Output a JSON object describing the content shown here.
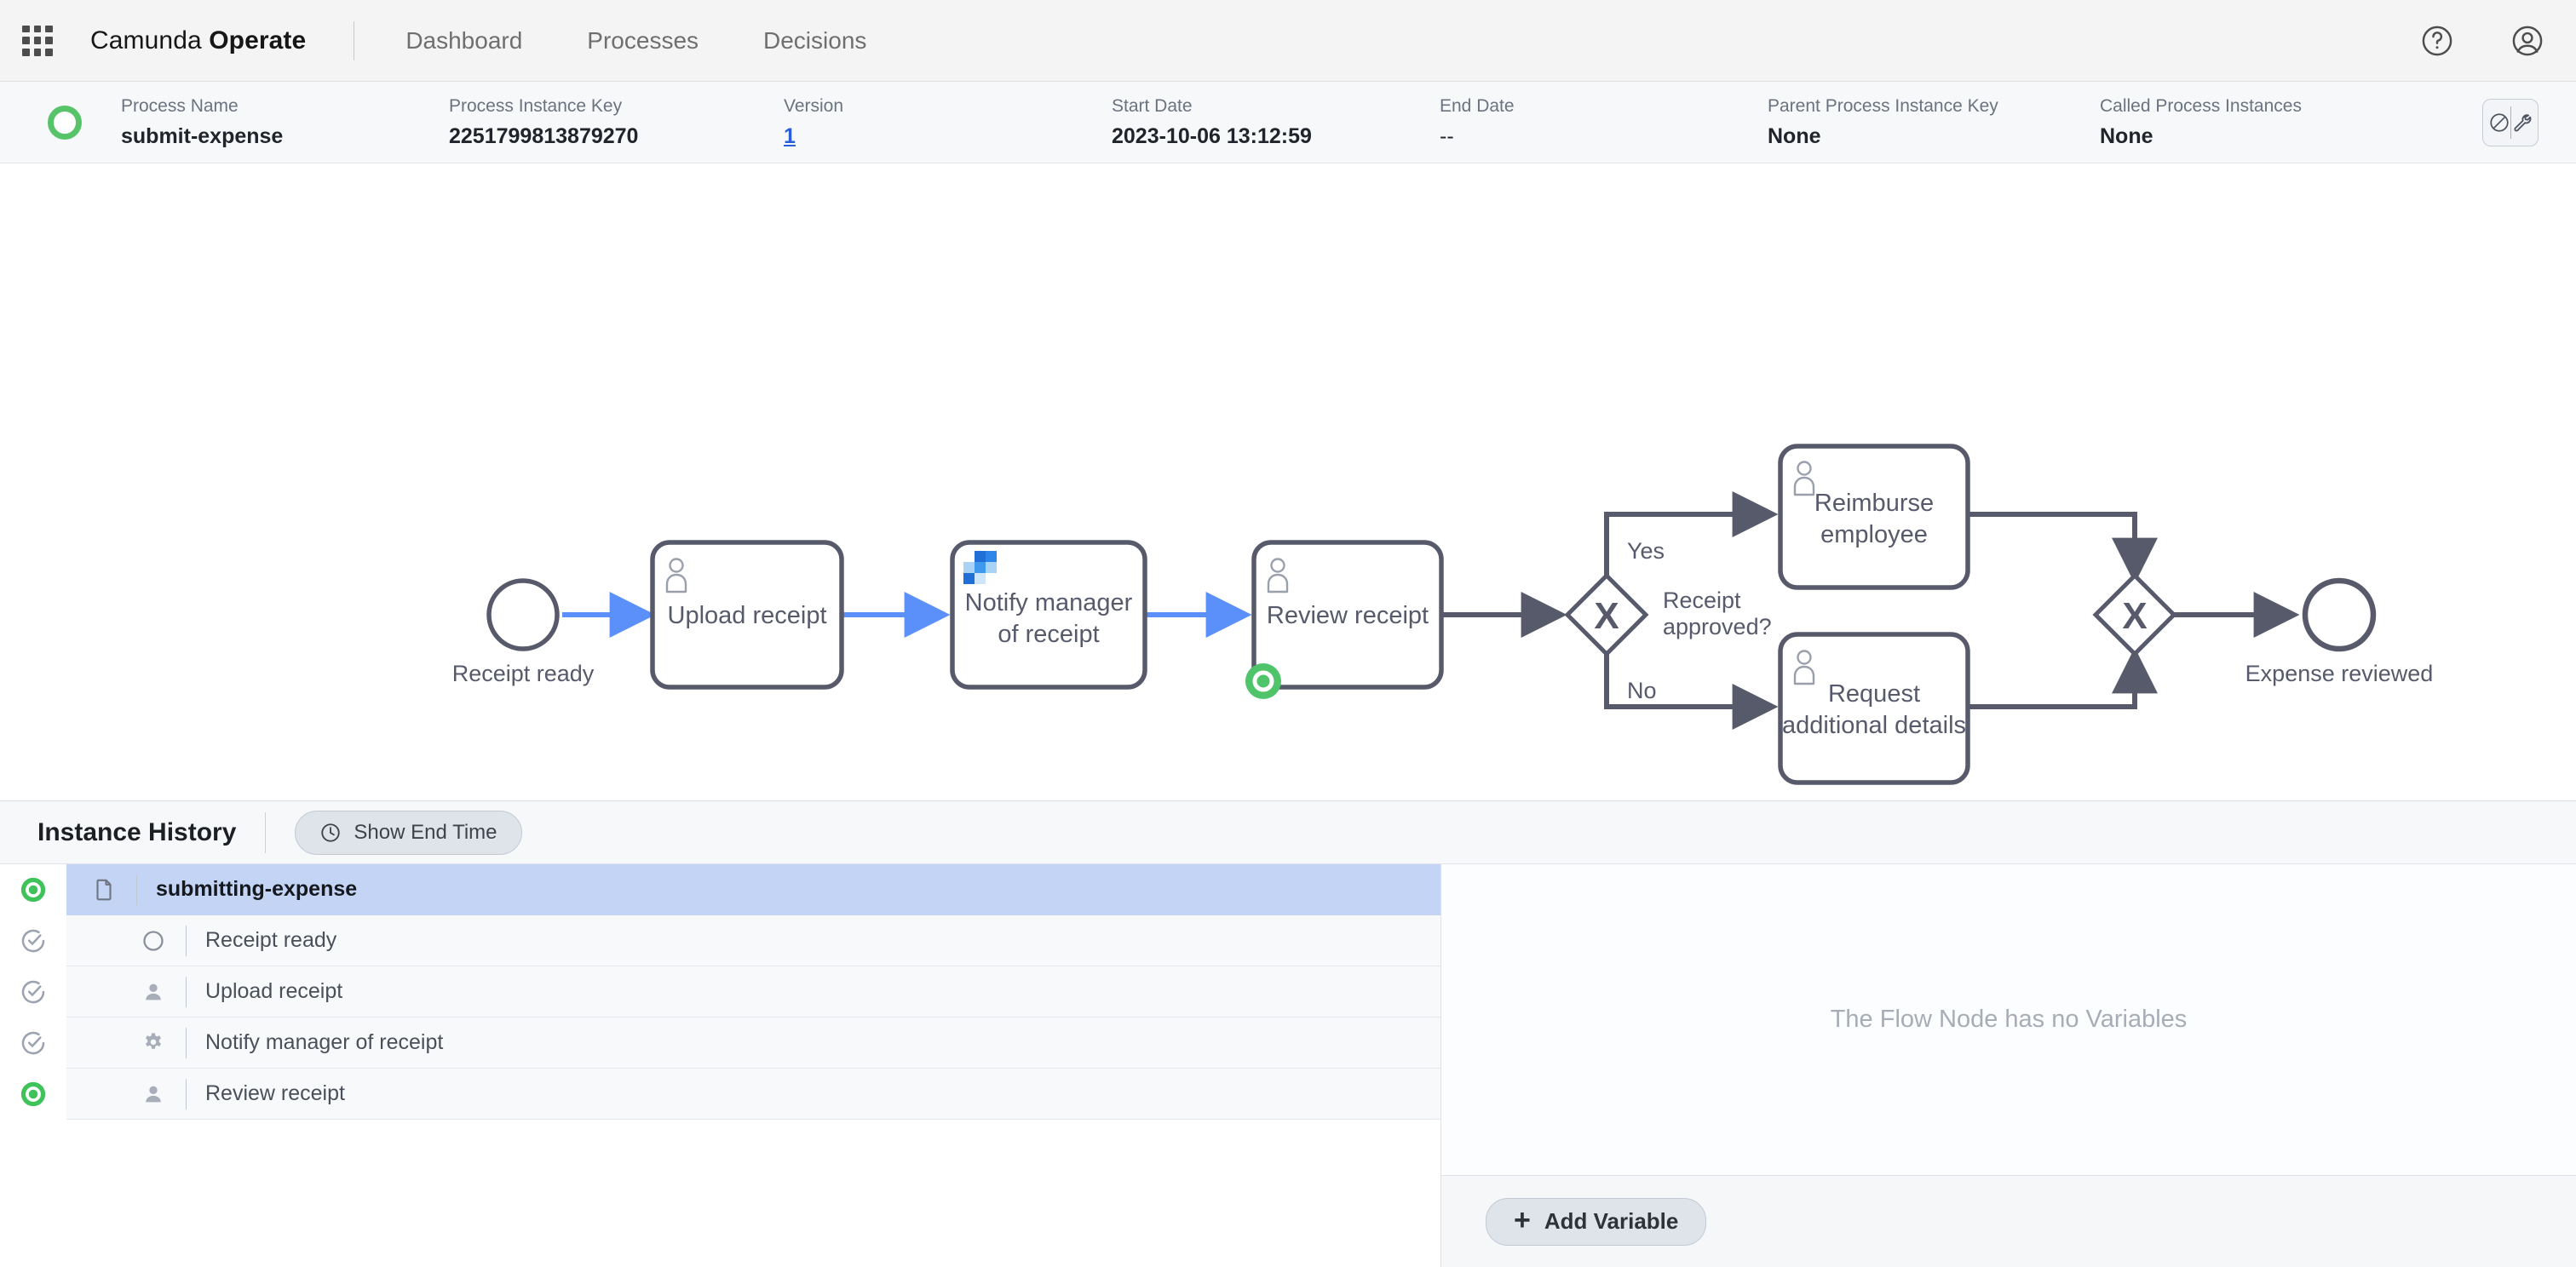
{
  "header": {
    "app_grid_icon": "app-grid-icon",
    "brand_first": "Camunda ",
    "brand_second": "Operate",
    "nav": [
      {
        "label": "Dashboard"
      },
      {
        "label": "Processes"
      },
      {
        "label": "Decisions"
      }
    ],
    "help_icon": "help-circle-icon",
    "user_icon": "user-avatar-icon"
  },
  "instance_meta": {
    "state": "active",
    "state_color": "#58c46a",
    "fields": [
      {
        "label": "Process Name",
        "value": "submit-expense",
        "style": "bold"
      },
      {
        "label": "Process Instance Key",
        "value": "2251799813879270",
        "style": "bold"
      },
      {
        "label": "Version",
        "value": "1",
        "style": "link"
      },
      {
        "label": "Start Date",
        "value": "2023-10-06 13:12:59",
        "style": "bold"
      },
      {
        "label": "End Date",
        "value": "--",
        "style": "plain"
      },
      {
        "label": "Parent Process Instance Key",
        "value": "None",
        "style": "bold"
      },
      {
        "label": "Called Process Instances",
        "value": "None",
        "style": "bold"
      }
    ],
    "actions": {
      "cancel_icon": "cancel-prohibited-icon",
      "modify_icon": "wrench-icon"
    }
  },
  "diagram": {
    "accent_active": "#5b8ff9",
    "stroke": "#565a6b",
    "active_badge_color": "#4fc46a",
    "nodes": [
      {
        "id": "start",
        "type": "start-event",
        "label": "Receipt ready",
        "state": "completed"
      },
      {
        "id": "upload",
        "type": "user-task",
        "label": "Upload receipt",
        "state": "completed"
      },
      {
        "id": "notify",
        "type": "service-task",
        "label": "Notify manager\nof receipt",
        "state": "completed"
      },
      {
        "id": "review",
        "type": "user-task",
        "label": "Review receipt",
        "state": "active"
      },
      {
        "id": "gateway1",
        "type": "exclusive-gateway",
        "label": "Receipt\napproved?",
        "state": "none"
      },
      {
        "id": "reimburse",
        "type": "user-task",
        "label": "Reimburse\nemployee",
        "state": "none"
      },
      {
        "id": "request",
        "type": "user-task",
        "label": "Request\nadditional details",
        "state": "none"
      },
      {
        "id": "gateway2",
        "type": "exclusive-gateway",
        "label": "",
        "state": "none"
      },
      {
        "id": "end",
        "type": "end-event",
        "label": "Expense reviewed",
        "state": "none"
      }
    ],
    "flow_labels": [
      {
        "id": "yes",
        "text": "Yes"
      },
      {
        "id": "no",
        "text": "No"
      }
    ],
    "node_text": {
      "start_label": "Receipt ready",
      "upload_label": "Upload receipt",
      "notify_line1": "Notify manager",
      "notify_line2": "of receipt",
      "review_label": "Review receipt",
      "gateway1_line1": "Receipt",
      "gateway1_line2": "approved?",
      "reimburse_line1": "Reimburse",
      "reimburse_line2": "employee",
      "request_line1": "Request",
      "request_line2": "additional details",
      "end_label": "Expense reviewed",
      "yes_label": "Yes",
      "no_label": "No",
      "gateway_symbol": "X"
    }
  },
  "instance_history": {
    "title": "Instance History",
    "show_end_time_label": "Show End Time",
    "clock_icon": "clock-icon",
    "rows": [
      {
        "label": "submitting-expense",
        "status": "active",
        "type_icon": "process-document-icon",
        "indent": false,
        "selected": true
      },
      {
        "label": "Receipt ready",
        "status": "completed",
        "type_icon": "start-event-icon",
        "indent": true,
        "selected": false
      },
      {
        "label": "Upload receipt",
        "status": "completed",
        "type_icon": "user-task-icon",
        "indent": true,
        "selected": false
      },
      {
        "label": "Notify manager of receipt",
        "status": "completed",
        "type_icon": "service-task-icon",
        "indent": true,
        "selected": false
      },
      {
        "label": "Review receipt",
        "status": "active",
        "type_icon": "user-task-icon",
        "indent": true,
        "selected": false
      }
    ]
  },
  "variables": {
    "empty_message": "The Flow Node has no Variables",
    "add_variable_label": "Add Variable",
    "plus_glyph": "+"
  }
}
